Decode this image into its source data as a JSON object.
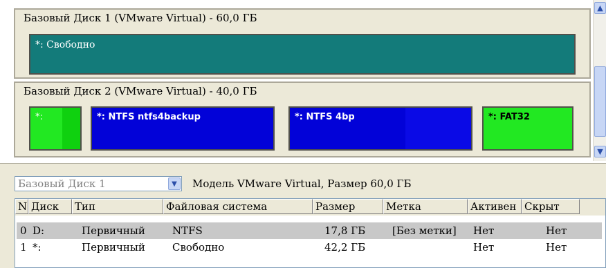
{
  "disk_map": {
    "disk1": {
      "title": "Базовый Диск 1 (VMware Virtual) - 60,0 ГБ",
      "partitions": [
        {
          "label": "*: Свободно",
          "color": "#137b7a"
        }
      ]
    },
    "disk2": {
      "title": "Базовый Диск 2 (VMware Virtual) - 40,0 ГБ",
      "partitions": [
        {
          "label": "*:",
          "color": "#22e822"
        },
        {
          "label": "*: NTFS ntfs4backup",
          "color": "#0202d8"
        },
        {
          "label": "*: NTFS 4bp",
          "color": "#0202d8"
        },
        {
          "label": "*: FAT32",
          "color": "#22e822"
        }
      ]
    },
    "scrollbar": {
      "up_icon": "▲",
      "down_icon": "▼"
    }
  },
  "details": {
    "disk_select": {
      "value": "Базовый Диск 1",
      "arrow": "▼"
    },
    "model_info": "Модель VMware Virtual, Размер 60,0 ГБ",
    "columns": [
      "N",
      "Диск",
      "Тип",
      "Файловая система",
      "Размер",
      "Метка",
      "Активен",
      "Скрыт"
    ],
    "rows": [
      {
        "n": "0",
        "disk": "D:",
        "type": "Первичный",
        "fs": "NTFS",
        "size": "17,8 ГБ",
        "label": "[Без метки]",
        "active": "Нет",
        "hidden": "Нет",
        "selected": true
      },
      {
        "n": "1",
        "disk": "*:",
        "type": "Первичный",
        "fs": "Свободно",
        "size": "42,2 ГБ",
        "label": "",
        "active": "Нет",
        "hidden": "Нет",
        "selected": false
      }
    ]
  }
}
